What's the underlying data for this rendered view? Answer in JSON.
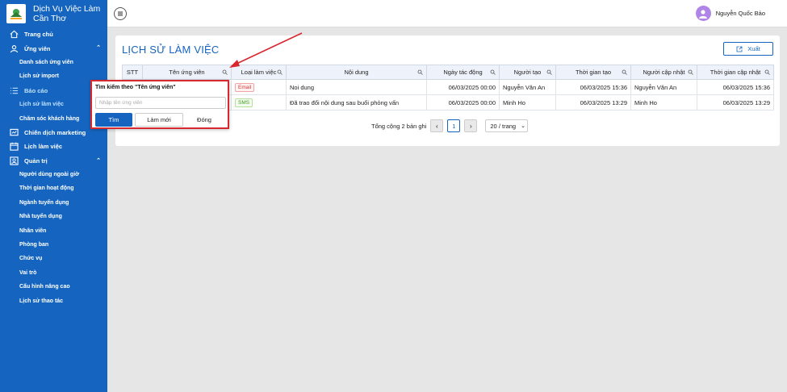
{
  "brand": {
    "title_line1": "Dịch Vụ Việc Làm",
    "title_line2": "Cần Thơ"
  },
  "sidebar": {
    "items": [
      {
        "label": "Trang chủ",
        "icon": "home-icon",
        "type": "item"
      },
      {
        "label": "Ứng viên",
        "icon": "user-icon",
        "type": "item",
        "expanded": true
      },
      {
        "label": "Danh sách ứng viên",
        "type": "sub"
      },
      {
        "label": "Lịch sử import",
        "type": "sub"
      },
      {
        "label": "Báo cáo",
        "icon": "list-icon",
        "type": "item",
        "active": true
      },
      {
        "label": "Lịch sử làm việc",
        "type": "sub",
        "active": true
      },
      {
        "label": "Chăm sóc khách hàng",
        "type": "sub"
      },
      {
        "label": "Chiến dịch marketing",
        "icon": "campaign-icon",
        "type": "item"
      },
      {
        "label": "Lịch làm việc",
        "icon": "calendar-icon",
        "type": "item"
      },
      {
        "label": "Quản trị",
        "icon": "admin-icon",
        "type": "item",
        "expanded": true
      },
      {
        "label": "Người dùng ngoài giờ",
        "type": "sub"
      },
      {
        "label": "Thời gian hoạt động",
        "type": "sub"
      },
      {
        "label": "Ngành tuyển dụng",
        "type": "sub"
      },
      {
        "label": "Nhà tuyển dụng",
        "type": "sub"
      },
      {
        "label": "Nhân viên",
        "type": "sub"
      },
      {
        "label": "Phòng ban",
        "type": "sub"
      },
      {
        "label": "Chức vụ",
        "type": "sub"
      },
      {
        "label": "Vai trò",
        "type": "sub"
      },
      {
        "label": "Cấu hình nâng cao",
        "type": "sub"
      },
      {
        "label": "Lịch sử thao tác",
        "type": "sub"
      }
    ]
  },
  "header": {
    "user_name": "Nguyễn Quốc Bảo"
  },
  "main": {
    "title": "LỊCH SỬ LÀM VIỆC",
    "export_label": "Xuất",
    "columns": [
      "STT",
      "Tên ứng viên",
      "Loại làm việc",
      "Nội dung",
      "Ngày tác động",
      "Người tạo",
      "Thời gian tạo",
      "Người cập nhật",
      "Thời gian cập nhật"
    ],
    "rows": [
      {
        "stt": "",
        "candidate": "",
        "type": "Email",
        "content": "Noi dung",
        "date": "06/03/2025 00:00",
        "creator": "Nguyễn Văn An",
        "created": "06/03/2025 15:36",
        "updater": "Nguyễn Văn An",
        "updated": "06/03/2025 15:36"
      },
      {
        "stt": "",
        "candidate": "",
        "type": "SMS",
        "content": "Đã trao đổi nội dung sau buổi phỏng vấn",
        "date": "06/03/2025 00:00",
        "creator": "Minh Ho",
        "created": "06/03/2025 13:29",
        "updater": "Minh Ho",
        "updated": "06/03/2025 13:29"
      }
    ],
    "pagination": {
      "total": "Tổng cộng 2 bản ghi",
      "page": "1",
      "page_size": "20 / trang",
      "prev": "‹",
      "next": "›"
    }
  },
  "popup": {
    "title": "Tìm kiếm theo \"Tên ứng viên\"",
    "placeholder": "Nhập tên ứng viên",
    "value": "",
    "search_label": "Tìm",
    "reset_label": "Làm mới",
    "close_label": "Đóng"
  },
  "colors": {
    "primary": "#1565c0",
    "highlight": "#d7282f",
    "email_tag": "#d03a3a",
    "sms_tag": "#3d9a1d"
  }
}
